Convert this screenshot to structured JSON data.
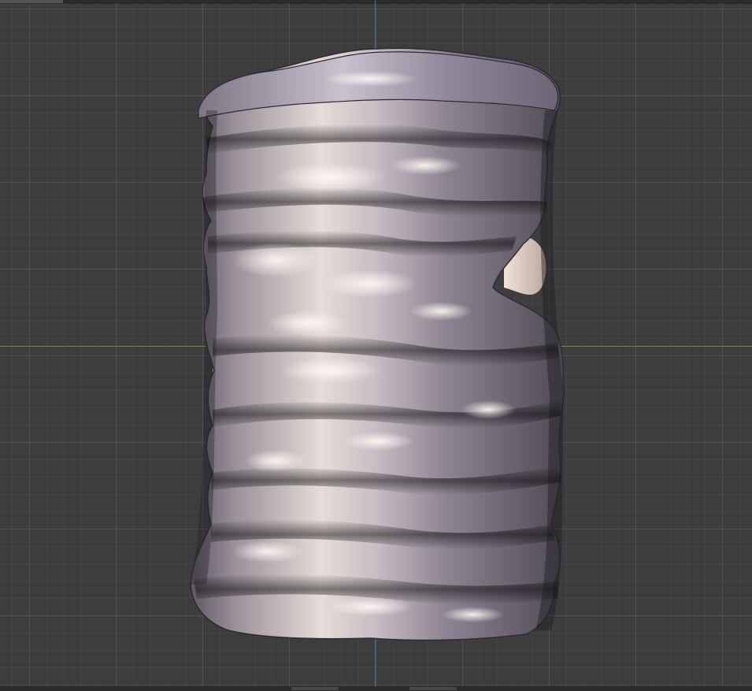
{
  "viewport": {
    "background_color": "#3d3d3d",
    "grid_color": "#4a4a4a",
    "axis_y_color": "#3e6ea8",
    "axis_x_color": "#6f8a2a"
  },
  "model": {
    "object": "wavy-vase-mesh",
    "material": "brushed-metal",
    "base_tint": "#a29ba6",
    "highlight_tint": "#f1ebe8",
    "inner_tint": "#d8c8bf"
  }
}
